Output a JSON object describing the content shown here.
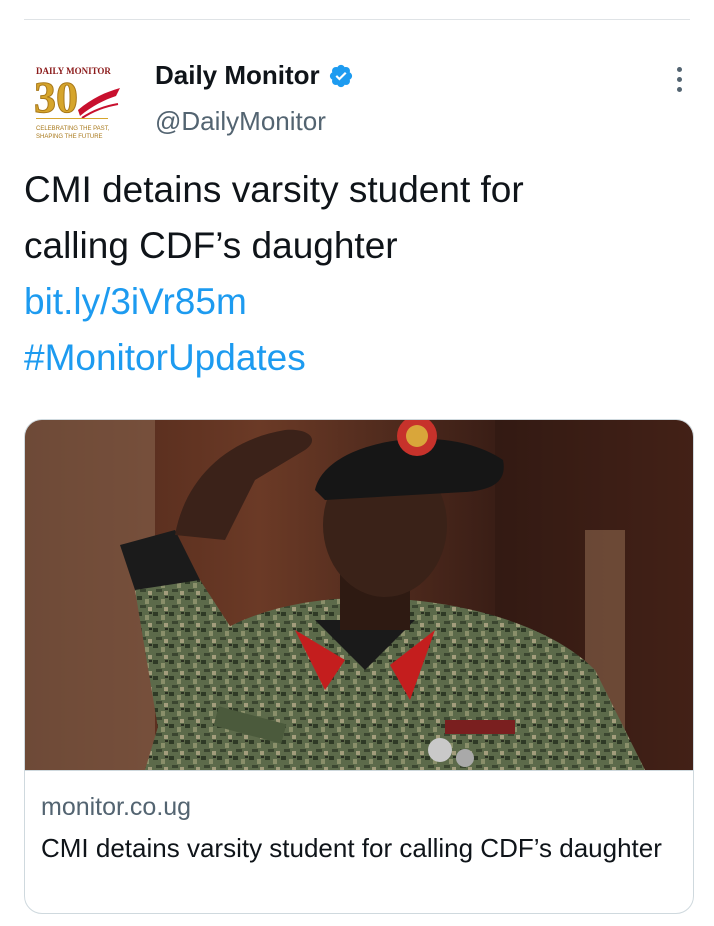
{
  "author": {
    "name": "Daily Monitor",
    "handle": "@DailyMonitor",
    "verified_icon": "verified-badge-icon",
    "avatar_logo_text": "DAILY MONITOR",
    "avatar_number": "30",
    "avatar_tagline_1": "CELEBRATING THE PAST,",
    "avatar_tagline_2": "SHAPING THE FUTURE"
  },
  "menu_icon": "more-options-icon",
  "tweet": {
    "line1": "CMI detains varsity student for",
    "line2": "calling CDF’s daughter",
    "link": "bit.ly/3iVr85m",
    "hashtag": "#MonitorUpdates"
  },
  "card": {
    "domain": "monitor.co.ug",
    "title": "CMI detains varsity student for calling CDF’s daughter"
  },
  "colors": {
    "link": "#1d9bf0",
    "verified": "#1d9bf0",
    "secondary_text": "#536471",
    "primary_text": "#0f1419",
    "border": "#cfd9de"
  }
}
